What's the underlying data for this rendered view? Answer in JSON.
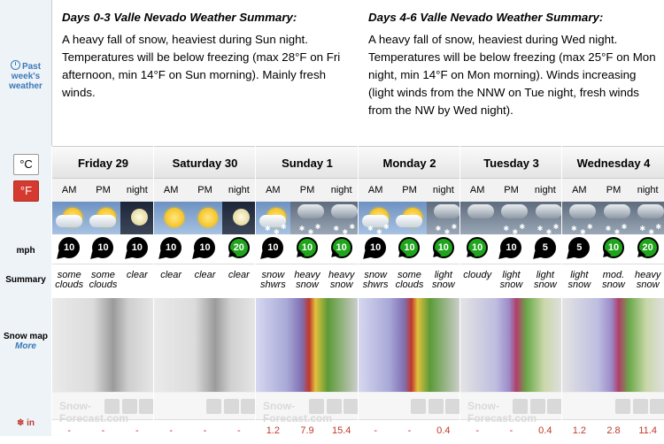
{
  "sidebar": {
    "past_line1": "Past",
    "past_line2": "week's",
    "past_line3": "weather",
    "celsius": "°C",
    "fahrenheit": "°F",
    "mph": "mph",
    "summary": "Summary",
    "snow_map": "Snow map",
    "more": "More",
    "unit_in": "in"
  },
  "summary": {
    "left_title": "Days 0-3 Valle Nevado Weather Summary:",
    "left_text": "A heavy fall of snow, heaviest during Sun night. Temperatures will be below freezing (max 28°F on Fri afternoon, min 14°F on Sun morning). Mainly fresh winds.",
    "right_title": "Days 4-6 Valle Nevado Weather Summary:",
    "right_text": "A heavy fall of snow, heaviest during Wed night. Temperatures will be below freezing (max 25°F on Mon night, min 14°F on Mon morning). Winds increasing (light winds from the NNW on Tue night, fresh winds from the NW by Wed night)."
  },
  "brand": "Snow-Forecast.com",
  "days": [
    {
      "name": "Friday 29",
      "map": "a",
      "periods": [
        {
          "label": "AM",
          "sky": "day",
          "icon": "sun-cloud",
          "wind": "10",
          "wg": false,
          "sum": "some clouds",
          "snow": "-"
        },
        {
          "label": "PM",
          "sky": "day",
          "icon": "sun-cloud",
          "wind": "10",
          "wg": false,
          "sum": "some clouds",
          "snow": "-"
        },
        {
          "label": "night",
          "sky": "night",
          "icon": "moon",
          "wind": "10",
          "wg": false,
          "sum": "clear",
          "snow": "-"
        }
      ]
    },
    {
      "name": "Saturday 30",
      "map": "a",
      "periods": [
        {
          "label": "AM",
          "sky": "day",
          "icon": "sun",
          "wind": "10",
          "wg": false,
          "sum": "clear",
          "snow": "-"
        },
        {
          "label": "PM",
          "sky": "day",
          "icon": "sun",
          "wind": "10",
          "wg": false,
          "sum": "clear",
          "snow": "-"
        },
        {
          "label": "night",
          "sky": "night",
          "icon": "moon",
          "wind": "20",
          "wg": true,
          "sum": "clear",
          "snow": "-"
        }
      ]
    },
    {
      "name": "Sunday 1",
      "map": "b",
      "periods": [
        {
          "label": "AM",
          "sky": "day",
          "icon": "sun-snow",
          "wind": "10",
          "wg": false,
          "sum": "snow shwrs",
          "snow": "1.2"
        },
        {
          "label": "PM",
          "sky": "storm",
          "icon": "snow",
          "wind": "10",
          "wg": true,
          "sum": "heavy snow",
          "snow": "7.9"
        },
        {
          "label": "night",
          "sky": "storm",
          "icon": "snow",
          "wind": "10",
          "wg": true,
          "sum": "heavy snow",
          "snow": "15.4"
        }
      ]
    },
    {
      "name": "Monday 2",
      "map": "b",
      "periods": [
        {
          "label": "AM",
          "sky": "day",
          "icon": "sun-snow",
          "wind": "10",
          "wg": false,
          "sum": "snow shwrs",
          "snow": "-"
        },
        {
          "label": "PM",
          "sky": "day",
          "icon": "sun-cloud",
          "wind": "10",
          "wg": true,
          "sum": "some clouds",
          "snow": "-"
        },
        {
          "label": "night",
          "sky": "storm",
          "icon": "snow",
          "wind": "10",
          "wg": true,
          "sum": "light snow",
          "snow": "0.4"
        }
      ]
    },
    {
      "name": "Tuesday 3",
      "map": "c",
      "periods": [
        {
          "label": "AM",
          "sky": "storm",
          "icon": "cloud",
          "wind": "10",
          "wg": true,
          "sum": "cloudy",
          "snow": "-"
        },
        {
          "label": "PM",
          "sky": "storm",
          "icon": "snow",
          "wind": "10",
          "wg": false,
          "sum": "light snow",
          "snow": "-"
        },
        {
          "label": "night",
          "sky": "storm",
          "icon": "snow",
          "wind": "5",
          "wg": false,
          "sum": "light snow",
          "snow": "0.4"
        }
      ]
    },
    {
      "name": "Wednesday 4",
      "map": "c",
      "periods": [
        {
          "label": "AM",
          "sky": "storm",
          "icon": "snow",
          "wind": "5",
          "wg": false,
          "sum": "light snow",
          "snow": "1.2"
        },
        {
          "label": "PM",
          "sky": "storm",
          "icon": "snow",
          "wind": "10",
          "wg": true,
          "sum": "mod. snow",
          "snow": "2.8"
        },
        {
          "label": "night",
          "sky": "storm",
          "icon": "snow",
          "wind": "20",
          "wg": true,
          "sum": "heavy snow",
          "snow": "11.4"
        }
      ]
    }
  ]
}
